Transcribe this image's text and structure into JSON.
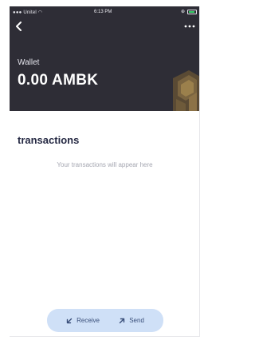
{
  "status_bar": {
    "carrier": "Unitel",
    "time": "6:13 PM"
  },
  "header": {
    "back_icon": "chevron-left-icon",
    "more_icon": "more-horizontal-icon"
  },
  "wallet": {
    "label": "Wallet",
    "balance": "0.00 AMBK"
  },
  "transactions": {
    "title": "transactions",
    "empty_message": "Your transactions will appear here"
  },
  "actions": {
    "receive_label": "Receive",
    "send_label": "Send"
  },
  "colors": {
    "header_bg": "#2e2d36",
    "title": "#262a44",
    "action_bar_bg": "#cfe0f7",
    "action_text": "#3a4f7a",
    "battery": "#38d36a"
  }
}
